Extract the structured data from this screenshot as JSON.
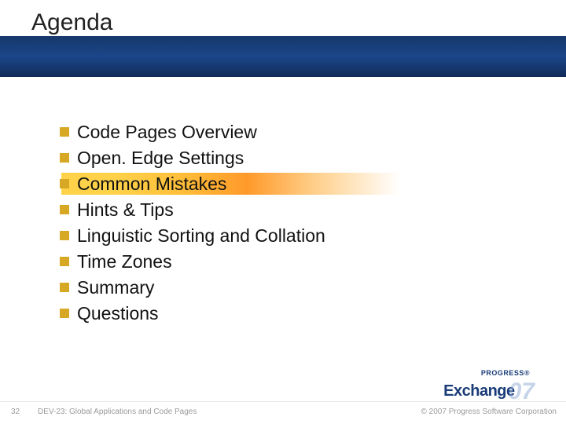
{
  "title": "Agenda",
  "highlight_index": 2,
  "items": [
    "Code Pages Overview",
    "Open. Edge Settings",
    "Common Mistakes",
    "Hints & Tips",
    "Linguistic Sorting and Collation",
    "Time Zones",
    "Summary",
    "Questions"
  ],
  "footer": {
    "slide_number": "32",
    "session": "DEV-23: Global Applications and Code Pages",
    "copyright": "© 2007 Progress Software Corporation"
  },
  "logo": {
    "top": "PROGRESS®",
    "main": "Exchange",
    "year": "07"
  }
}
